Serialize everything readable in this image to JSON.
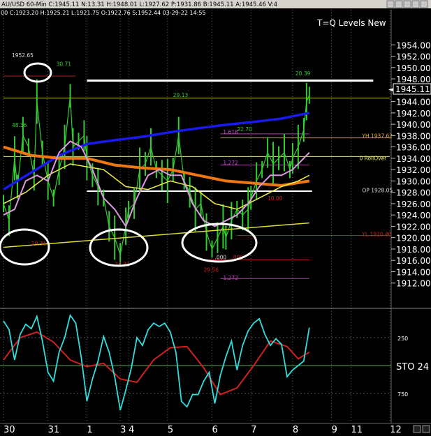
{
  "header": {
    "text": "AU/USD  60-Min  C:1945.11  N:13.31  H:1948.01  L:1927.62  P:1931.86  B:1945.11  A:1945.46  V:4",
    "sub": "00  C:1923.20  H:1925.21  L:1921.75  O:1922.76  S:1952.44  03-29-22  14:55"
  },
  "title": "T=Q Levels New",
  "colors": {
    "background": "#000000",
    "price": "#33cc33",
    "ma_blue": "#1a1aee",
    "ma_orange": "#ee7711",
    "ma_yellow_fast": "#eeee44",
    "ma_violet": "#dd99dd",
    "long_yellow": "#dddd33",
    "stoch_cyan": "#33dddd",
    "stoch_red": "#cc2222",
    "grid": "#aaaaaa",
    "circle": "#ffffff"
  },
  "chart_data": [
    {
      "type": "line",
      "title": "T=Q Levels New",
      "x_tick_labels": [
        "30",
        "31",
        "1",
        "3",
        "4",
        "5",
        "6",
        "7",
        "8",
        "9",
        "11",
        "12"
      ],
      "x_tick_index": [
        0,
        16,
        30,
        42,
        45,
        59,
        75,
        89,
        104,
        118,
        125,
        139
      ],
      "ylim": [
        1910,
        1956
      ],
      "y_ticks": [
        1912,
        1914,
        1916,
        1918,
        1920,
        1922,
        1924,
        1926,
        1928,
        1930,
        1932,
        1934,
        1936,
        1938,
        1940,
        1942,
        1944,
        1946,
        1948,
        1950,
        1952,
        1954
      ],
      "y_tick_labels": [
        "1912.00",
        "1914.00",
        "1916.00",
        "1918.00",
        "1920.00",
        "1922.00",
        "1924.00",
        "1926.00",
        "1928.00",
        "1930.00",
        "1932.00",
        "1934.00",
        "1936.00",
        "1938.00",
        "1940.00",
        "1942.00",
        "1944.00",
        "1946.00",
        "1948.00",
        "1950.00",
        "1952.00",
        "1954.00"
      ],
      "last_price_label": "1945.11",
      "last_price": 1945.11,
      "series": [
        {
          "kind": "price",
          "x": [
            0,
            2,
            4,
            5,
            7,
            9,
            11,
            12,
            14,
            16,
            18,
            20,
            22,
            24,
            25,
            27,
            29,
            30,
            32,
            34,
            36,
            38,
            40,
            42,
            44,
            45,
            47,
            49,
            51,
            53,
            55,
            57,
            59,
            61,
            63,
            65,
            67,
            69,
            71,
            73,
            75,
            77,
            79,
            80,
            82,
            84,
            86,
            88,
            89,
            91,
            93,
            95,
            97,
            99,
            101,
            103,
            104,
            106,
            108,
            109,
            110
          ],
          "values": [
            1926,
            1923,
            1934,
            1929,
            1938,
            1936,
            1931,
            1944,
            1935,
            1930,
            1927,
            1932,
            1936,
            1945,
            1936,
            1937,
            1938,
            1934,
            1931,
            1929,
            1927,
            1922,
            1920,
            1917,
            1922,
            1925,
            1926,
            1932,
            1933,
            1936,
            1932,
            1931,
            1930,
            1932,
            1938,
            1930,
            1928,
            1925,
            1926,
            1921,
            1918,
            1920,
            1922,
            1920,
            1923,
            1925,
            1924,
            1925,
            1927,
            1930,
            1932,
            1935,
            1933,
            1934,
            1935,
            1932,
            1934,
            1936,
            1939,
            1944,
            1945.11
          ]
        },
        {
          "kind": "ma",
          "name": "blue",
          "x": [
            0,
            10,
            20,
            30,
            40,
            50,
            60,
            70,
            80,
            90,
            100,
            110
          ],
          "values": [
            1928.5,
            1931.5,
            1934.5,
            1936.5,
            1937.2,
            1937.8,
            1938.6,
            1939.3,
            1939.9,
            1940.4,
            1941,
            1942
          ]
        },
        {
          "kind": "ma",
          "name": "orange",
          "x": [
            0,
            10,
            20,
            30,
            40,
            50,
            60,
            70,
            80,
            90,
            100,
            110
          ],
          "values": [
            1936,
            1934.5,
            1934,
            1934,
            1932.8,
            1932.3,
            1932,
            1931,
            1930,
            1929.6,
            1929.2,
            1930
          ]
        },
        {
          "kind": "ma",
          "name": "yellow-fast",
          "x": [
            0,
            8,
            16,
            24,
            30,
            36,
            44,
            52,
            60,
            68,
            76,
            84,
            92,
            100,
            106,
            110
          ],
          "values": [
            1926,
            1928,
            1931,
            1933,
            1932.5,
            1932,
            1929,
            1928.5,
            1930,
            1929,
            1926,
            1925,
            1927,
            1929,
            1930,
            1931
          ]
        },
        {
          "kind": "ma",
          "name": "violet",
          "x": [
            0,
            4,
            8,
            12,
            16,
            20,
            24,
            28,
            32,
            36,
            40,
            44,
            48,
            52,
            56,
            60,
            64,
            68,
            72,
            76,
            80,
            84,
            88,
            92,
            96,
            100,
            104,
            108,
            110
          ],
          "values": [
            1924,
            1925,
            1930,
            1931,
            1930,
            1935,
            1937,
            1936,
            1932,
            1927,
            1925,
            1922,
            1927,
            1931,
            1932,
            1931,
            1931,
            1926,
            1923,
            1922,
            1923,
            1924,
            1926,
            1929,
            1931,
            1931,
            1932,
            1934,
            1935
          ]
        },
        {
          "kind": "trend",
          "name": "long-yellow",
          "x": [
            0,
            110
          ],
          "values": [
            1918.3,
            1922.6
          ]
        }
      ],
      "horizontal_levels": [
        {
          "value": 1947.7,
          "x_from": 30,
          "x_to": 133,
          "color": "#ffffff",
          "width": 3
        },
        {
          "value": 1928.2,
          "x_from": 30,
          "x_to": 111,
          "color": "#ffffff",
          "width": 2
        },
        {
          "value": 1944.6,
          "x_from": 0,
          "x_to": 140,
          "color": "#bbbb22",
          "width": 1
        },
        {
          "value": 1934.3,
          "x_from": 0,
          "x_to": 140,
          "color": "#dddd88",
          "width": 1
        },
        {
          "value": 1937.6,
          "x_from": 78,
          "x_to": 140,
          "color": "#cc8844",
          "width": 1
        },
        {
          "value": 1920.4,
          "x_from": 84,
          "x_to": 140,
          "color": "#aa2222",
          "width": 1
        },
        {
          "value": 1916.1,
          "x_from": 74,
          "x_to": 110,
          "color": "#aa2222",
          "width": 1
        },
        {
          "value": 1948.5,
          "x_from": 0,
          "x_to": 26,
          "color": "#aa2222",
          "width": 1
        },
        {
          "value": 1938.3,
          "x_from": 78,
          "x_to": 110,
          "color": "#aa44aa",
          "width": 1
        },
        {
          "value": 1932.8,
          "x_from": 78,
          "x_to": 110,
          "color": "#aa44aa",
          "width": 1
        },
        {
          "value": 1912.8,
          "x_from": 78,
          "x_to": 110,
          "color": "#aa44aa",
          "width": 1
        }
      ],
      "annotations": [
        {
          "text": "1952.65",
          "x": 3,
          "y": 1951.8,
          "color": "#dddddd"
        },
        {
          "text": "30.71",
          "x": 19,
          "y": 1950.3,
          "color": "#33cc33"
        },
        {
          "text": "20.39",
          "x": 105,
          "y": 1948.6,
          "color": "#33cc33"
        },
        {
          "text": "29.13",
          "x": 61,
          "y": 1944.8,
          "color": "#33cc33"
        },
        {
          "text": "48.36",
          "x": 3,
          "y": 1939.5,
          "color": "#33cc33"
        },
        {
          "text": "22.70",
          "x": 84,
          "y": 1938.8,
          "color": "#33cc33"
        },
        {
          "text": "1.618",
          "x": 79,
          "y": 1938.3,
          "color": "#cc44cc"
        },
        {
          "text": "YH 1937.62",
          "x": 129,
          "y": 1937.6,
          "color": "#ddaa44"
        },
        {
          "text": "1.272",
          "x": 79,
          "y": 1932.9,
          "color": "#cc44cc"
        },
        {
          "text": "0 RollOver",
          "x": 128,
          "y": 1933.7,
          "color": "#eeee66"
        },
        {
          "text": "OP 1928.05",
          "x": 129,
          "y": 1928.0,
          "color": "#dddddd"
        },
        {
          "text": "10.00",
          "x": 95,
          "y": 1926.6,
          "color": "#cc2222"
        },
        {
          "text": "YL 1920.40",
          "x": 129,
          "y": 1920.3,
          "color": "#cc2222"
        },
        {
          "text": "19.31",
          "x": 10,
          "y": 1918.6,
          "color": "#cc2222"
        },
        {
          "text": ".000",
          "x": 76,
          "y": 1916.2,
          "color": "#dddddd"
        },
        {
          "text": ".000",
          "x": 82,
          "y": 1916.2,
          "color": "#cc2222"
        },
        {
          "text": "34.31",
          "x": 40,
          "y": 1915.0,
          "color": "#cc2222"
        },
        {
          "text": "29.56",
          "x": 72,
          "y": 1914.0,
          "color": "#cc2222"
        },
        {
          "text": "1.272",
          "x": 79,
          "y": 1912.6,
          "color": "#cc44cc"
        }
      ],
      "grid": true
    },
    {
      "type": "line",
      "title": "STO 24",
      "ylim": [
        0,
        1000
      ],
      "y_ticks": [
        250,
        500,
        750
      ],
      "y_tick_labels": [
        "250",
        "STO  24",
        "750"
      ],
      "series": [
        {
          "kind": "fast",
          "x": [
            0,
            2,
            4,
            6,
            8,
            10,
            12,
            14,
            16,
            18,
            20,
            22,
            24,
            26,
            28,
            30,
            32,
            34,
            36,
            38,
            40,
            42,
            44,
            46,
            48,
            50,
            52,
            54,
            56,
            58,
            60,
            62,
            64,
            66,
            68,
            70,
            72,
            74,
            76,
            78,
            80,
            82,
            84,
            86,
            88,
            90,
            92,
            94,
            96,
            98,
            100,
            102,
            104,
            106,
            108,
            110
          ],
          "values": [
            100,
            180,
            450,
            220,
            130,
            170,
            60,
            280,
            560,
            640,
            380,
            250,
            50,
            120,
            430,
            820,
            620,
            460,
            240,
            380,
            600,
            900,
            720,
            520,
            250,
            320,
            180,
            120,
            150,
            120,
            200,
            380,
            820,
            870,
            760,
            760,
            640,
            560,
            840,
            590,
            420,
            280,
            540,
            320,
            190,
            120,
            80,
            220,
            320,
            260,
            310,
            600,
            540,
            500,
            460,
            160
          ]
        },
        {
          "kind": "slow",
          "x": [
            0,
            6,
            12,
            18,
            24,
            30,
            36,
            42,
            48,
            54,
            60,
            66,
            72,
            78,
            84,
            90,
            96,
            102,
            106,
            110
          ],
          "values": [
            450,
            250,
            200,
            290,
            450,
            510,
            480,
            620,
            650,
            450,
            340,
            330,
            520,
            760,
            700,
            500,
            280,
            330,
            440,
            380
          ]
        }
      ]
    }
  ]
}
